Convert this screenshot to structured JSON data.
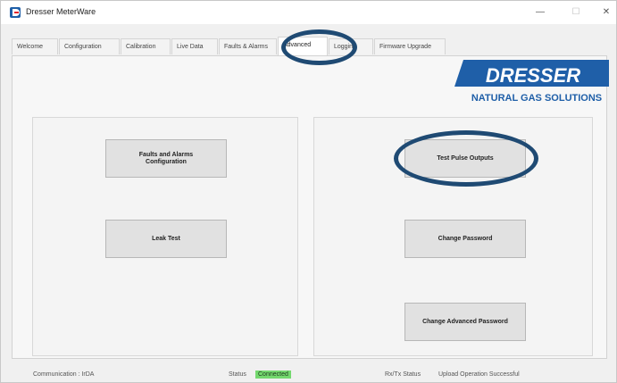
{
  "window": {
    "title": "Dresser MeterWare",
    "icon": "dresser-app-icon",
    "controls": {
      "minimize": "—",
      "maximize": "☐",
      "close": "✕"
    }
  },
  "tabs": [
    {
      "label": "Welcome"
    },
    {
      "label": "Configuration"
    },
    {
      "label": "Calibration"
    },
    {
      "label": "Live Data"
    },
    {
      "label": "Faults & Alarms"
    },
    {
      "label": "Advanced",
      "active": true
    },
    {
      "label": "Logging"
    },
    {
      "label": "Firmware Upgrade"
    }
  ],
  "logo": {
    "brand": "DRESSER",
    "tagline": "NATURAL GAS SOLUTIONS",
    "color": "#1f5fa8"
  },
  "left_panel": {
    "faults_button": "Faults and Alarms Configuration",
    "leak_button": "Leak Test"
  },
  "right_panel": {
    "test_pulse_button": "Test Pulse Outputs",
    "change_password_button": "Change Password",
    "change_advanced_password_button": "Change Advanced Password"
  },
  "status_bar": {
    "communication_label": "Communication : IrDA",
    "status_label": "Status",
    "status_value": "Connected",
    "rxtx_label": "Rx/Tx Status",
    "rxtx_value": "Upload Operation Successful"
  },
  "colors": {
    "highlight_ring": "#1f4a73",
    "connected": "#74d86e"
  }
}
